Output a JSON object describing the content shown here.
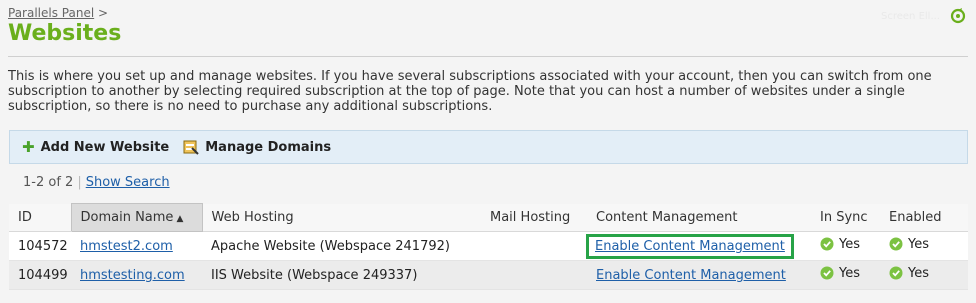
{
  "breadcrumb": {
    "link": "Parallels Panel",
    "separator": ">"
  },
  "page_title": "Websites",
  "top_right_faint": "Screen  Ell...",
  "intro": "This is where you set up and manage websites. If you have several subscriptions associated with your account, then you can switch from one subscription to another by selecting required subscription at the top of page. Note that you can host a number of websites under a single subscription, so there is no need to purchase any additional subscriptions.",
  "toolbar": {
    "add_label": "Add New Website",
    "manage_label": "Manage Domains"
  },
  "pager": {
    "count": "1-2 of 2",
    "show_search": "Show Search"
  },
  "table": {
    "headers": {
      "id": "ID",
      "domain": "Domain Name",
      "hosting": "Web Hosting",
      "mail": "Mail Hosting",
      "cm": "Content Management",
      "sync": "In Sync",
      "enabled": "Enabled"
    },
    "rows": [
      {
        "id": "104572",
        "domain": "hmstest2.com",
        "hosting": "Apache Website (Webspace 241792)",
        "mail": "",
        "cm": "Enable Content Management",
        "sync": "Yes",
        "enabled": "Yes"
      },
      {
        "id": "104499",
        "domain": "hmstesting.com",
        "hosting": "IIS Website (Webspace 249337)",
        "mail": "",
        "cm": "Enable Content Management",
        "sync": "Yes",
        "enabled": "Yes"
      }
    ]
  },
  "colors": {
    "title_green": "#6aaf1c",
    "link_blue": "#1e5fa8",
    "highlight_green": "#27a347",
    "toolbar_bg": "#e3eef7"
  },
  "icons": {
    "refresh": "refresh-icon",
    "add": "plus-icon",
    "manage_domains": "domains-icon",
    "status_ok": "check-circle-icon",
    "sort": "sort-ascending-icon"
  }
}
